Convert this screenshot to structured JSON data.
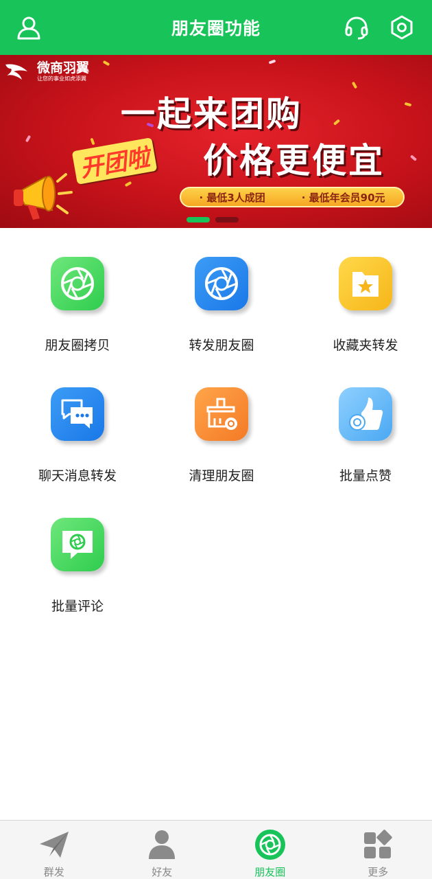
{
  "header": {
    "title": "朋友圈功能",
    "left_icon": "user-icon",
    "right_icons": [
      "headset-icon",
      "settings-hex-icon"
    ]
  },
  "banner": {
    "brand_name": "微商羽翼",
    "brand_slogan": "让您的事业如虎添翼",
    "headline1": "一起来团购",
    "headline2": "价格更便宜",
    "sticker": "开团啦",
    "pill_item1": "· 最低3人成团",
    "pill_item2": "· 最低年会员90元",
    "carousel_active_index": 0,
    "carousel_count": 2
  },
  "features": [
    {
      "label": "朋友圈拷贝",
      "icon": "shutter-icon",
      "color": "#3dd55a"
    },
    {
      "label": "转发朋友圈",
      "icon": "shutter-icon",
      "color": "#1f82ec"
    },
    {
      "label": "收藏夹转发",
      "icon": "folder-star-icon",
      "color": "#f8c127"
    },
    {
      "label": "聊天消息转发",
      "icon": "chat-bubbles-icon",
      "color": "#1f82ec"
    },
    {
      "label": "清理朋友圈",
      "icon": "broom-icon",
      "color": "#f7882f"
    },
    {
      "label": "批量点赞",
      "icon": "thumbs-up-icon",
      "color": "#58b3f5"
    },
    {
      "label": "批量评论",
      "icon": "comment-shutter-icon",
      "color": "#3dd55a"
    }
  ],
  "bottom_nav": {
    "active_index": 2,
    "items": [
      {
        "label": "群发",
        "icon": "paper-plane-icon"
      },
      {
        "label": "好友",
        "icon": "person-icon"
      },
      {
        "label": "朋友圈",
        "icon": "shutter-icon"
      },
      {
        "label": "更多",
        "icon": "grid-more-icon"
      }
    ]
  },
  "colors": {
    "primary_green": "#18c35a",
    "banner_red": "#d4161f",
    "nav_inactive": "#888888"
  }
}
